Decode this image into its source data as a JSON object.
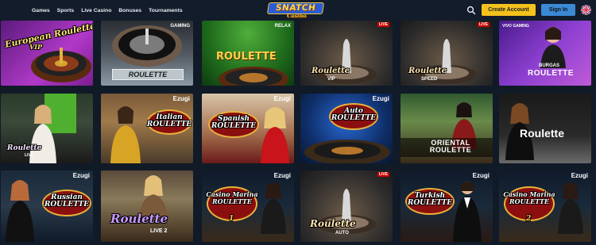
{
  "header": {
    "nav": [
      "Games",
      "Sports",
      "Live Casino",
      "Bonuses",
      "Tournaments"
    ],
    "logo": "SNATCH",
    "logo_sub": "Casino",
    "create_account": "Create Account",
    "sign_in": "Sign In"
  },
  "tiles": [
    {
      "title": "European Roulette",
      "subtitle": "VIP",
      "badge": ""
    },
    {
      "title": "ROULETTE",
      "subtitle": "",
      "badge": "GAMING"
    },
    {
      "title": "ROULETTE",
      "subtitle": "",
      "badge": "RELAX"
    },
    {
      "title": "Roulette",
      "subtitle": "VIP",
      "badge": "LIVE"
    },
    {
      "title": "Roulette",
      "subtitle": "SPEED",
      "badge": "LIVE"
    },
    {
      "title": "ROULETTE",
      "subtitle": "BURGAS",
      "badge": "VIVO GAMING"
    },
    {
      "title": "Roulette",
      "subtitle": "LIVE",
      "badge": ""
    },
    {
      "title": "Italian ROULETTE",
      "subtitle": "",
      "badge": "Ezugi"
    },
    {
      "title": "Spanish ROULETTE",
      "subtitle": "",
      "badge": "Ezugi"
    },
    {
      "title": "Auto ROULETTE",
      "subtitle": "",
      "badge": "Ezugi"
    },
    {
      "title": "ORIENTAL ROULETTE",
      "subtitle": "",
      "badge": ""
    },
    {
      "title": "Roulette",
      "subtitle": "",
      "badge": ""
    },
    {
      "title": "Russian ROULETTE",
      "subtitle": "",
      "badge": "Ezugi"
    },
    {
      "title": "Roulette",
      "subtitle": "LIVE 2",
      "badge": ""
    },
    {
      "title": "Casino Marina ROULETTE",
      "subtitle": "1",
      "badge": "Ezugi"
    },
    {
      "title": "Roulette",
      "subtitle": "AUTO",
      "badge": "LIVE"
    },
    {
      "title": "Turkish ROULETTE",
      "subtitle": "",
      "badge": "Ezugi"
    },
    {
      "title": "Casino Marina ROULETTE",
      "subtitle": "2",
      "badge": "Ezugi"
    }
  ]
}
